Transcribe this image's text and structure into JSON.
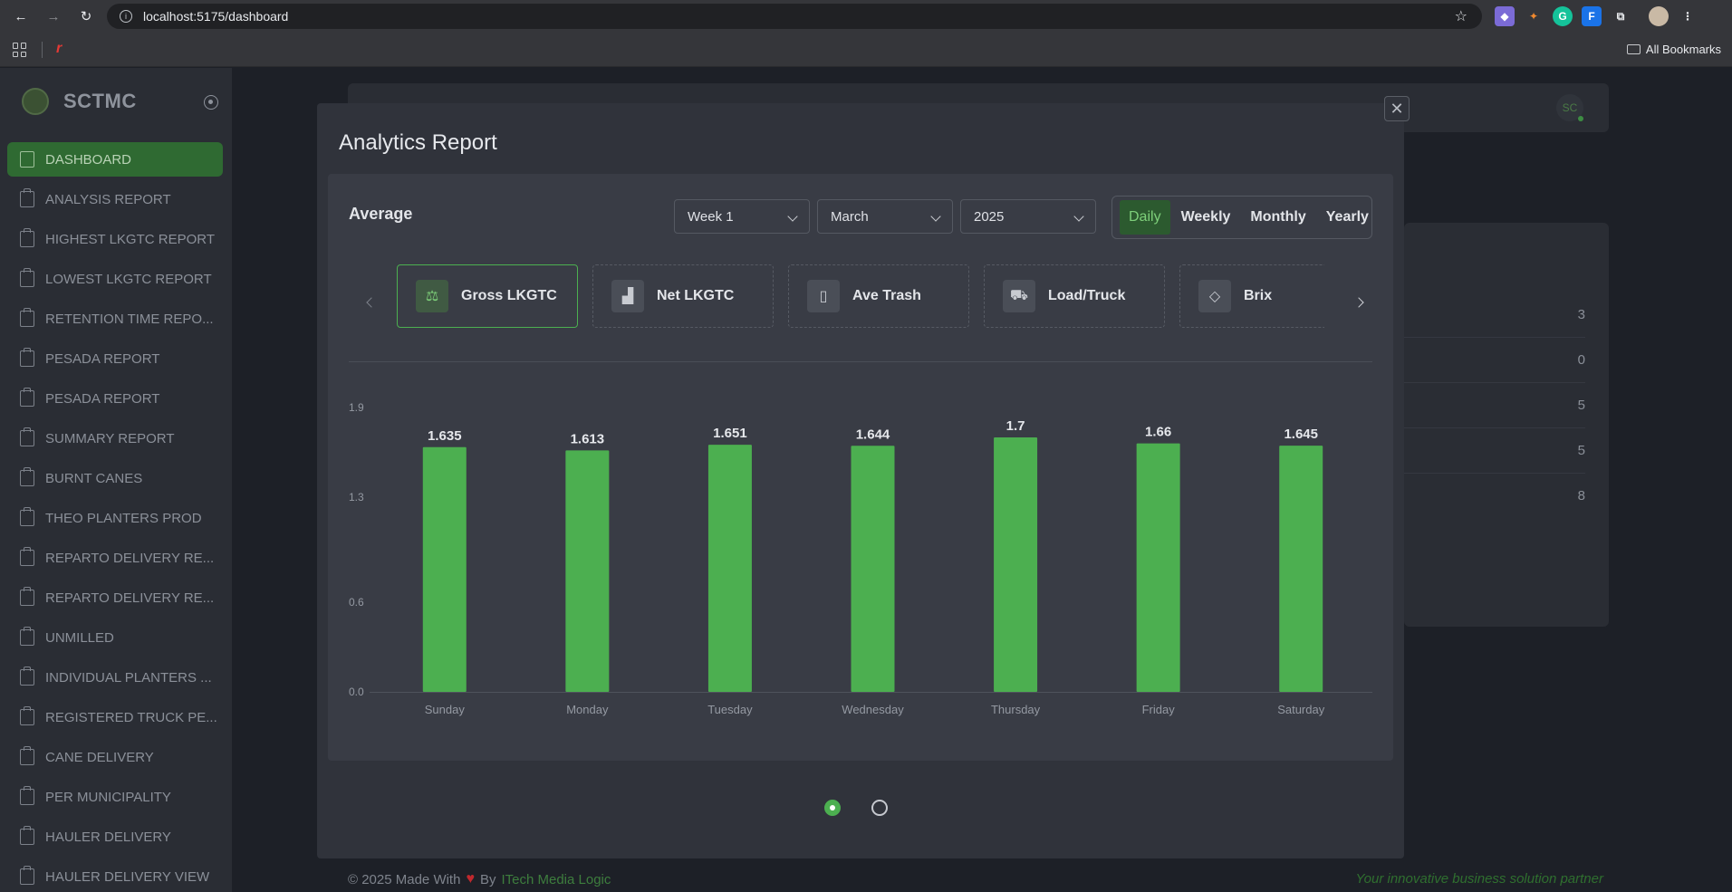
{
  "browser": {
    "url": "localhost:5175/dashboard",
    "all_bookmarks": "All Bookmarks"
  },
  "sidebar": {
    "brand": "SCTMC",
    "items": [
      {
        "label": "DASHBOARD",
        "active": true
      },
      {
        "label": "ANALYSIS REPORT"
      },
      {
        "label": "HIGHEST LKGTC REPORT"
      },
      {
        "label": "LOWEST LKGTC REPORT"
      },
      {
        "label": "RETENTION TIME REPO..."
      },
      {
        "label": "PESADA REPORT"
      },
      {
        "label": "PESADA REPORT"
      },
      {
        "label": "SUMMARY REPORT"
      },
      {
        "label": "BURNT CANES"
      },
      {
        "label": "THEO PLANTERS PROD"
      },
      {
        "label": "REPARTO DELIVERY RE..."
      },
      {
        "label": "REPARTO DELIVERY RE..."
      },
      {
        "label": "UNMILLED"
      },
      {
        "label": "INDIVIDUAL PLANTERS ..."
      },
      {
        "label": "REGISTERED TRUCK PE..."
      },
      {
        "label": "CANE DELIVERY"
      },
      {
        "label": "PER MUNICIPALITY"
      },
      {
        "label": "HAULER DELIVERY"
      },
      {
        "label": "HAULER DELIVERY VIEW"
      }
    ]
  },
  "header": {
    "avatar": "SC"
  },
  "background_values": [
    "3",
    "0",
    "5",
    "5",
    "8"
  ],
  "footer": {
    "prefix": "© 2025 Made With",
    "by": "By",
    "company": "ITech Media Logic",
    "tagline": "Your innovative business solution partner"
  },
  "modal": {
    "title": "Analytics Report",
    "card_title": "Average",
    "filters": {
      "week": "Week 1",
      "month": "March",
      "year": "2025"
    },
    "periods": [
      {
        "label": "Daily",
        "active": true
      },
      {
        "label": "Weekly"
      },
      {
        "label": "Monthly"
      },
      {
        "label": "Yearly"
      }
    ],
    "metrics": [
      {
        "label": "Gross LKGTC",
        "icon": "scale-icon",
        "active": true
      },
      {
        "label": "Net LKGTC",
        "icon": "chart-icon"
      },
      {
        "label": "Ave Trash",
        "icon": "trash-icon"
      },
      {
        "label": "Load/Truck",
        "icon": "truck-icon"
      },
      {
        "label": "Brix",
        "icon": "droplet-icon"
      }
    ]
  },
  "chart_data": {
    "type": "bar",
    "categories": [
      "Sunday",
      "Monday",
      "Tuesday",
      "Wednesday",
      "Thursday",
      "Friday",
      "Saturday"
    ],
    "values": [
      1.635,
      1.613,
      1.651,
      1.644,
      1.7,
      1.66,
      1.645
    ],
    "value_labels": [
      "1.635",
      "1.613",
      "1.651",
      "1.644",
      "1.7",
      "1.66",
      "1.645"
    ],
    "y_ticks": [
      "0.0",
      "0.6",
      "1.3",
      "1.9"
    ],
    "ylim": [
      0,
      1.9
    ],
    "bar_color": "#4caf50",
    "grid": false
  }
}
